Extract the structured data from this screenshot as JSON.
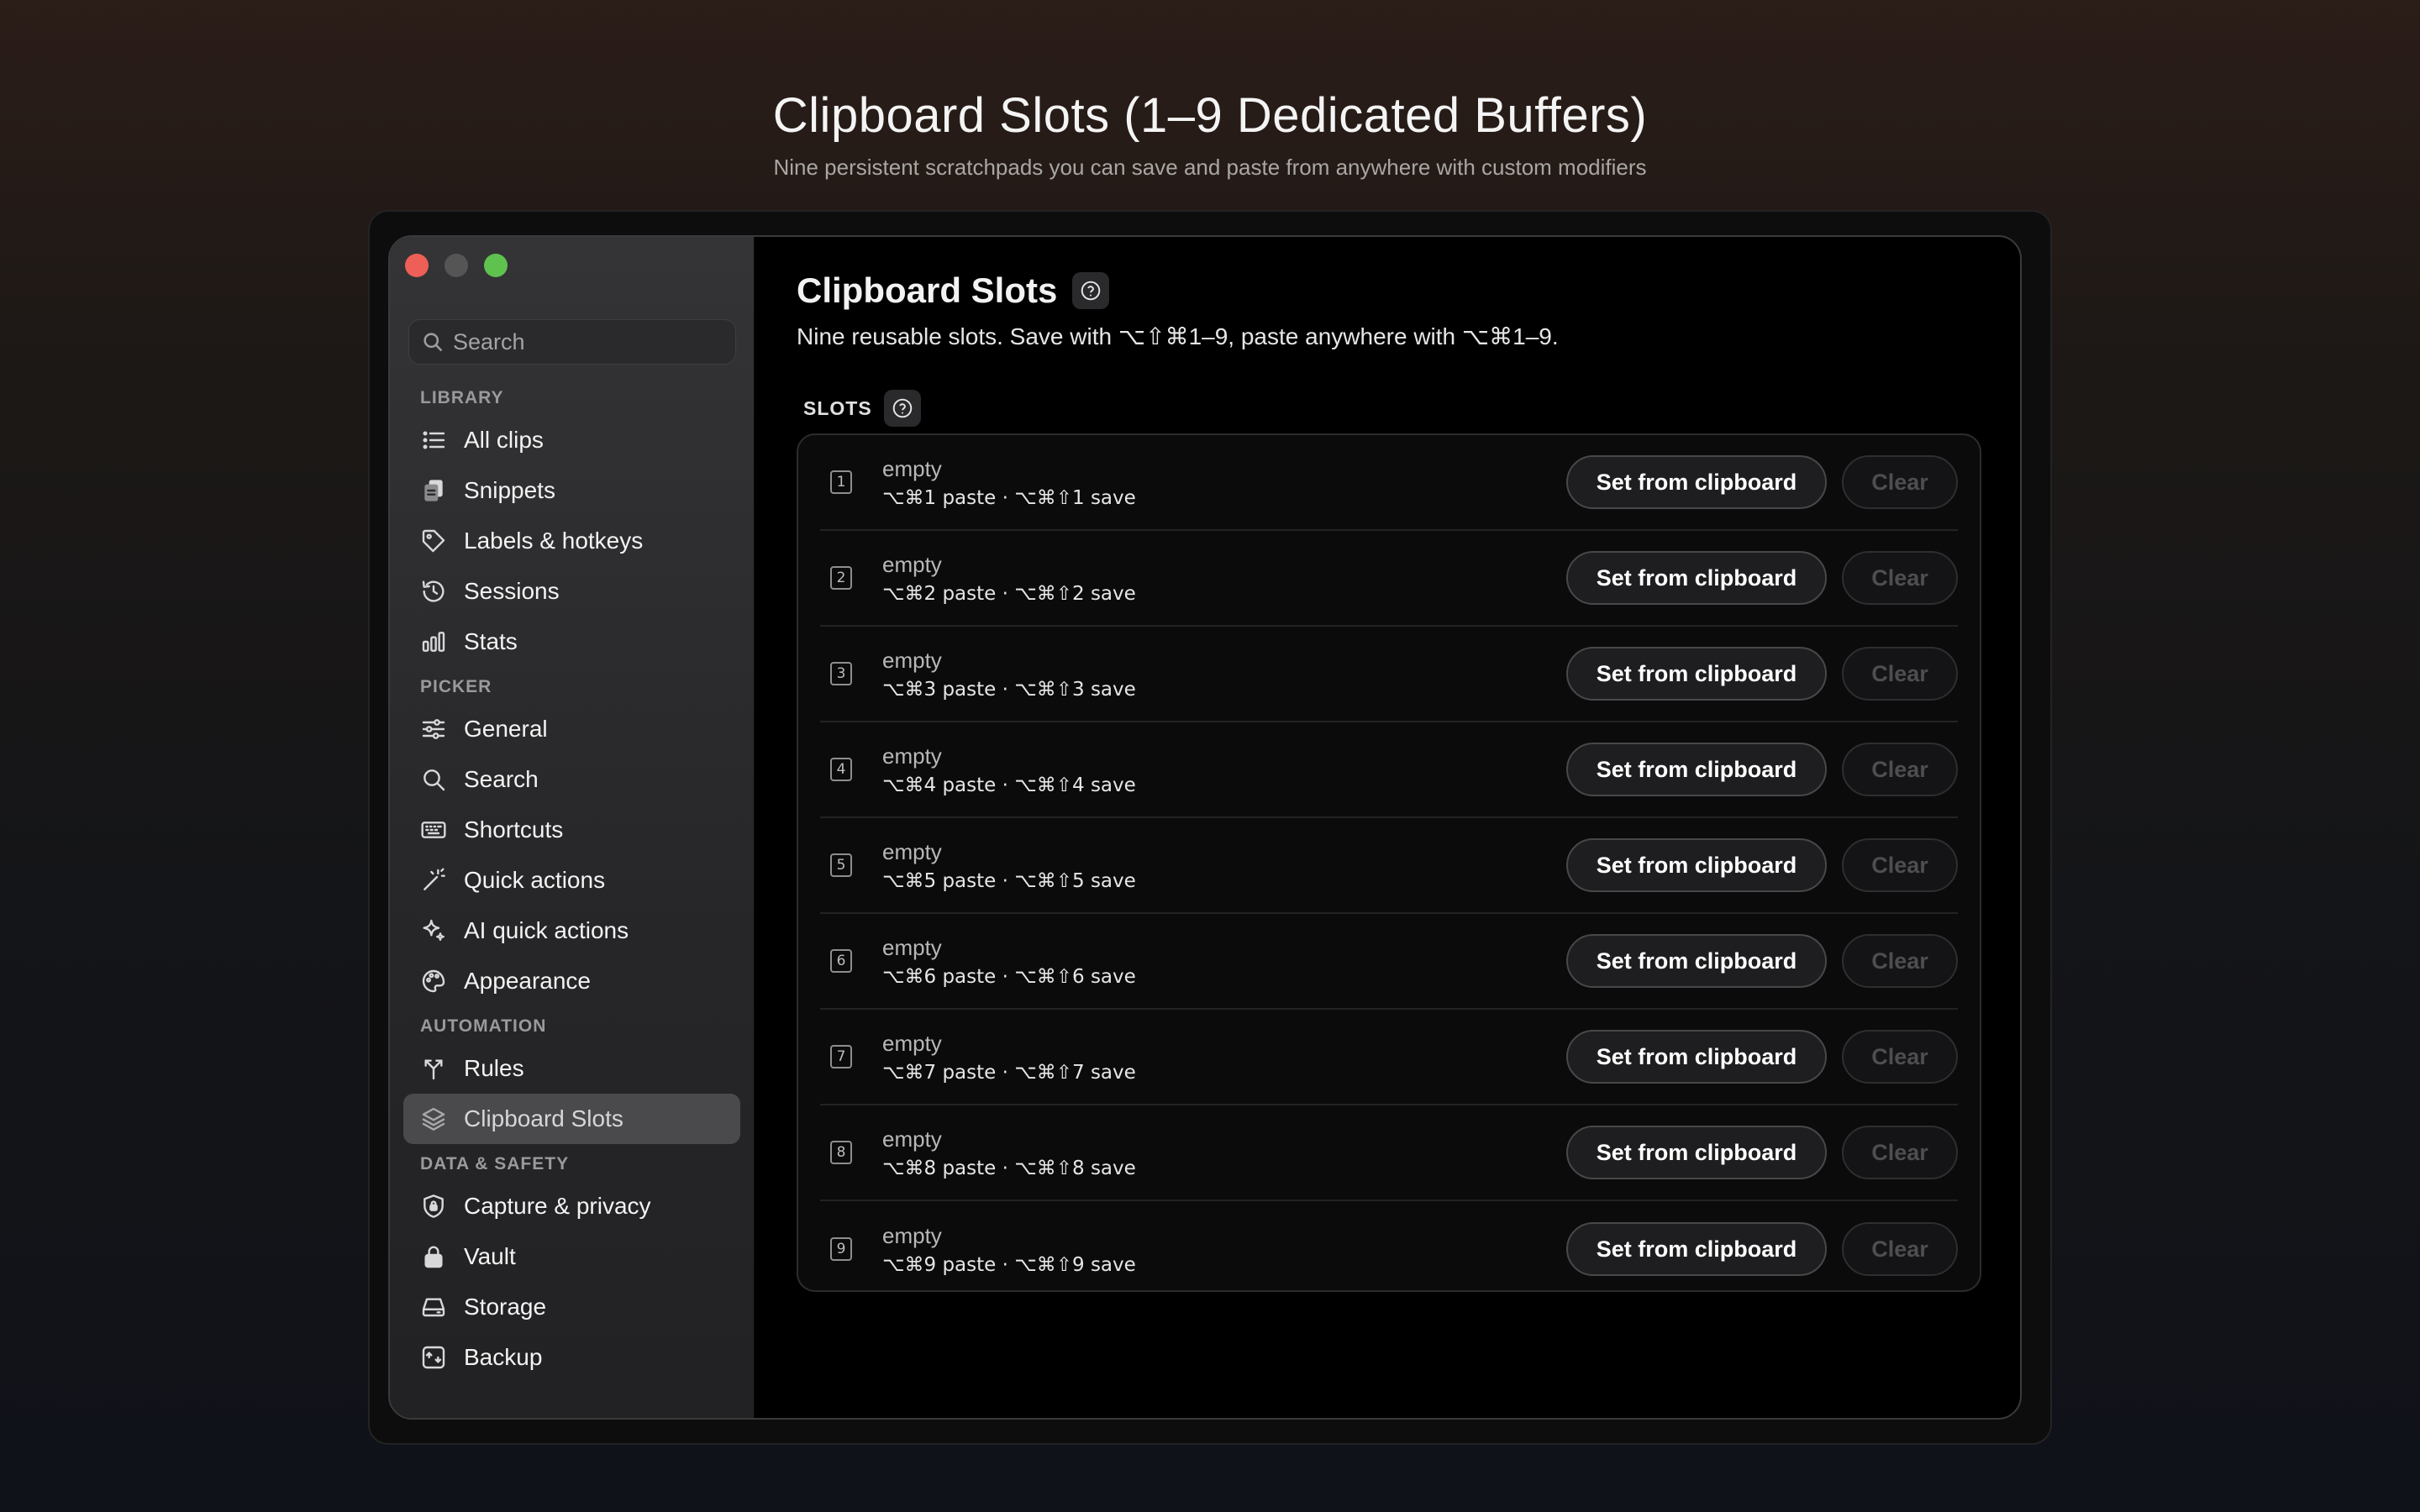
{
  "hero": {
    "title": "Clipboard Slots (1–9 Dedicated Buffers)",
    "subtitle": "Nine persistent scratchpads you can save and paste from anywhere with custom modifiers"
  },
  "sidebar": {
    "search_placeholder": "Search",
    "sections": [
      {
        "title": "LIBRARY",
        "items": [
          {
            "label": "All clips",
            "icon": "list-icon"
          },
          {
            "label": "Snippets",
            "icon": "document-icon"
          },
          {
            "label": "Labels & hotkeys",
            "icon": "tag-icon"
          },
          {
            "label": "Sessions",
            "icon": "history-icon"
          },
          {
            "label": "Stats",
            "icon": "bar-chart-icon"
          }
        ]
      },
      {
        "title": "PICKER",
        "items": [
          {
            "label": "General",
            "icon": "sliders-icon"
          },
          {
            "label": "Search",
            "icon": "search-icon"
          },
          {
            "label": "Shortcuts",
            "icon": "keyboard-icon"
          },
          {
            "label": "Quick actions",
            "icon": "magic-wand-icon"
          },
          {
            "label": "AI quick actions",
            "icon": "sparkles-icon"
          },
          {
            "label": "Appearance",
            "icon": "palette-icon"
          }
        ]
      },
      {
        "title": "AUTOMATION",
        "items": [
          {
            "label": "Rules",
            "icon": "split-arrow-icon"
          },
          {
            "label": "Clipboard Slots",
            "icon": "layers-icon",
            "active": true
          }
        ]
      },
      {
        "title": "DATA & SAFETY",
        "items": [
          {
            "label": "Capture & privacy",
            "icon": "shield-icon"
          },
          {
            "label": "Vault",
            "icon": "lock-icon"
          },
          {
            "label": "Storage",
            "icon": "drive-icon"
          },
          {
            "label": "Backup",
            "icon": "backup-icon"
          }
        ]
      }
    ]
  },
  "main": {
    "title": "Clipboard Slots",
    "subtitle": "Nine reusable slots. Save with ⌥⇧⌘1–9, paste anywhere with ⌥⌘1–9.",
    "slots_header": "SLOTS",
    "set_label": "Set from clipboard",
    "clear_label": "Clear",
    "slots": [
      {
        "num": "1",
        "state": "empty",
        "keys": "⌥⌘1 paste · ⌥⌘⇧1 save"
      },
      {
        "num": "2",
        "state": "empty",
        "keys": "⌥⌘2 paste · ⌥⌘⇧2 save"
      },
      {
        "num": "3",
        "state": "empty",
        "keys": "⌥⌘3 paste · ⌥⌘⇧3 save"
      },
      {
        "num": "4",
        "state": "empty",
        "keys": "⌥⌘4 paste · ⌥⌘⇧4 save"
      },
      {
        "num": "5",
        "state": "empty",
        "keys": "⌥⌘5 paste · ⌥⌘⇧5 save"
      },
      {
        "num": "6",
        "state": "empty",
        "keys": "⌥⌘6 paste · ⌥⌘⇧6 save"
      },
      {
        "num": "7",
        "state": "empty",
        "keys": "⌥⌘7 paste · ⌥⌘⇧7 save"
      },
      {
        "num": "8",
        "state": "empty",
        "keys": "⌥⌘8 paste · ⌥⌘⇧8 save"
      },
      {
        "num": "9",
        "state": "empty",
        "keys": "⌥⌘9 paste · ⌥⌘⇧9 save"
      }
    ]
  }
}
